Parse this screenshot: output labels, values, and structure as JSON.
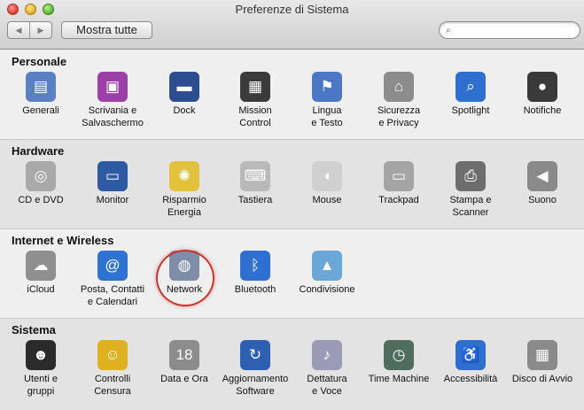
{
  "window": {
    "title": "Preferenze di Sistema"
  },
  "toolbar": {
    "back_icon": "◀",
    "forward_icon": "▶",
    "show_all_label": "Mostra tutte",
    "search_value": "",
    "search_placeholder": ""
  },
  "sections": {
    "personal": {
      "title": "Personale",
      "items": [
        {
          "label": "Generali",
          "icon": "general-icon",
          "glyph": "▤",
          "color": "#5a7fc2"
        },
        {
          "label": "Scrivania e\nSalvaschermo",
          "icon": "desktop-screensaver-icon",
          "glyph": "▣",
          "color": "#9c3fa6"
        },
        {
          "label": "Dock",
          "icon": "dock-icon",
          "glyph": "▬",
          "color": "#2c4d8f"
        },
        {
          "label": "Mission\nControl",
          "icon": "mission-control-icon",
          "glyph": "▦",
          "color": "#3b3b3b"
        },
        {
          "label": "Lingua\ne Testo",
          "icon": "language-text-icon",
          "glyph": "⚑",
          "color": "#4b77c4"
        },
        {
          "label": "Sicurezza\ne Privacy",
          "icon": "security-privacy-icon",
          "glyph": "⌂",
          "color": "#8c8c8c"
        },
        {
          "label": "Spotlight",
          "icon": "spotlight-icon",
          "glyph": "⌕",
          "color": "#2f6fd0"
        },
        {
          "label": "Notifiche",
          "icon": "notifications-icon",
          "glyph": "●",
          "color": "#3a3a3a"
        }
      ]
    },
    "hardware": {
      "title": "Hardware",
      "items": [
        {
          "label": "CD e DVD",
          "icon": "cd-dvd-icon",
          "glyph": "◎",
          "color": "#a9a9a9"
        },
        {
          "label": "Monitor",
          "icon": "monitor-icon",
          "glyph": "▭",
          "color": "#2e5aa3"
        },
        {
          "label": "Risparmio\nEnergia",
          "icon": "energy-saver-icon",
          "glyph": "✺",
          "color": "#e2c23b"
        },
        {
          "label": "Tastiera",
          "icon": "keyboard-icon",
          "glyph": "⌨",
          "color": "#b9b9b9"
        },
        {
          "label": "Mouse",
          "icon": "mouse-icon",
          "glyph": "◖",
          "color": "#d0d0d0"
        },
        {
          "label": "Trackpad",
          "icon": "trackpad-icon",
          "glyph": "▭",
          "color": "#a4a4a4"
        },
        {
          "label": "Stampa e\nScanner",
          "icon": "print-scan-icon",
          "glyph": "⎙",
          "color": "#6d6d6d"
        },
        {
          "label": "Suono",
          "icon": "sound-icon",
          "glyph": "◀",
          "color": "#8a8a8a"
        }
      ]
    },
    "internet": {
      "title": "Internet e Wireless",
      "items": [
        {
          "label": "iCloud",
          "icon": "icloud-icon",
          "glyph": "☁",
          "color": "#8f8f8f"
        },
        {
          "label": "Posta, Contatti\ne Calendari",
          "icon": "mail-contacts-calendars-icon",
          "glyph": "@",
          "color": "#2f73d1"
        },
        {
          "label": "Network",
          "icon": "network-icon",
          "glyph": "◍",
          "color": "#7e8ea8"
        },
        {
          "label": "Bluetooth",
          "icon": "bluetooth-icon",
          "glyph": "ᛒ",
          "color": "#2f6fd0"
        },
        {
          "label": "Condivisione",
          "icon": "sharing-icon",
          "glyph": "▲",
          "color": "#6aa6d6"
        }
      ]
    },
    "system": {
      "title": "Sistema",
      "items": [
        {
          "label": "Utenti e\ngruppi",
          "icon": "users-groups-icon",
          "glyph": "☻",
          "color": "#2b2b2b"
        },
        {
          "label": "Controlli\nCensura",
          "icon": "parental-controls-icon",
          "glyph": "☺",
          "color": "#e0b11f"
        },
        {
          "label": "Data e Ora",
          "icon": "date-time-icon",
          "glyph": "18",
          "color": "#8c8c8c"
        },
        {
          "label": "Aggiornamento\nSoftware",
          "icon": "software-update-icon",
          "glyph": "↻",
          "color": "#2f5fb0"
        },
        {
          "label": "Dettatura\ne Voce",
          "icon": "dictation-speech-icon",
          "glyph": "♪",
          "color": "#9b9bb8"
        },
        {
          "label": "Time Machine",
          "icon": "time-machine-icon",
          "glyph": "◷",
          "color": "#4f6d5d"
        },
        {
          "label": "Accessibilità",
          "icon": "accessibility-icon",
          "glyph": "♿",
          "color": "#2f6fd0"
        },
        {
          "label": "Disco di Avvio",
          "icon": "startup-disk-icon",
          "glyph": "▦",
          "color": "#8a8a8a"
        }
      ]
    }
  }
}
